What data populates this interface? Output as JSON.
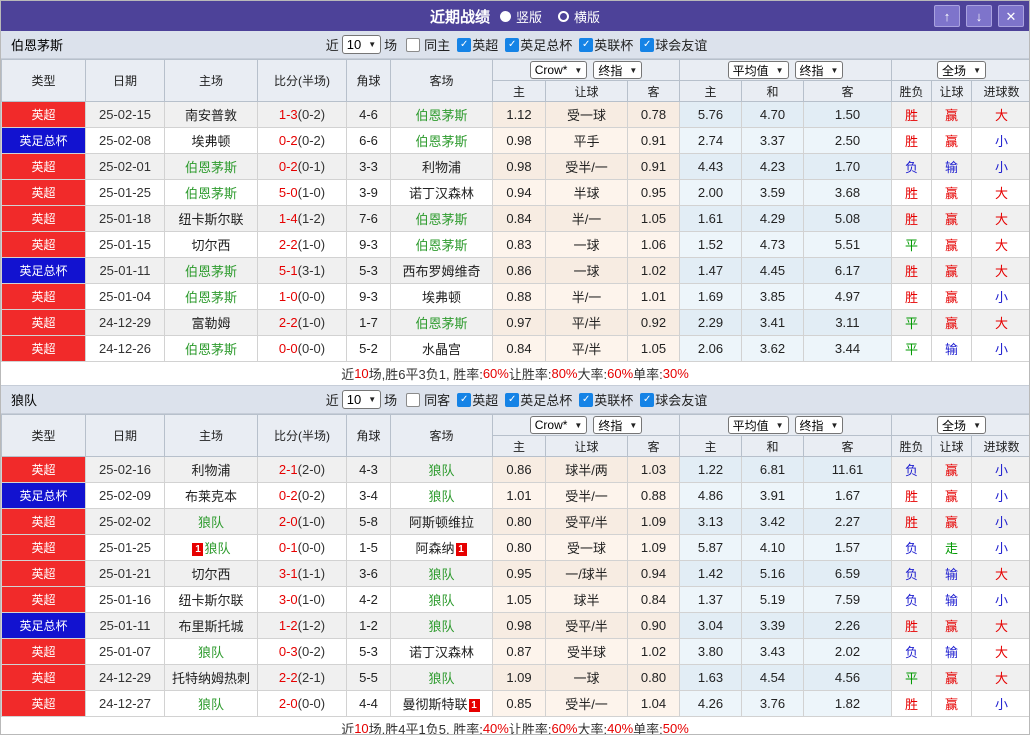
{
  "colors": {
    "titlebar_bg": "#4d4299",
    "titlebar_button_bg": "#7e74cb",
    "section_bg": "#dce2ec",
    "header_bg": "#e9edf3",
    "checkbox_accent": "#1583e6",
    "focal_team": "#2e9b2e",
    "odds_tint": "#fdf4ec",
    "avg_tint": "#edf5fa"
  },
  "league_colors": {
    "英超": "#f12a2a",
    "英足总杯": "#1212d0"
  },
  "result_colors": {
    "r": "#e60000",
    "g": "#009900",
    "b": "#2020d0"
  },
  "icons": {
    "check": "✓",
    "dropdown": "▼"
  },
  "titlebar": {
    "title": "近期战绩",
    "radios": [
      {
        "label": "竖版",
        "selected": true
      },
      {
        "label": "横版",
        "selected": false
      }
    ],
    "buttons": {
      "up": "↑",
      "down": "↓",
      "close": "✕"
    }
  },
  "filter": {
    "near": "近",
    "count": "10",
    "unit": "场",
    "leagues": [
      "英超",
      "英足总杯",
      "英联杯",
      "球会友谊"
    ]
  },
  "table_header": {
    "type": "类型",
    "date": "日期",
    "home": "主场",
    "score": "比分(半场)",
    "corner": "角球",
    "away": "客场",
    "dd_odds_source": "Crow*",
    "dd_odds_time": "终指",
    "dd_avg_source": "平均值",
    "dd_avg_time": "终指",
    "dd_scope": "全场",
    "odds_home": "主",
    "odds_handicap": "让球",
    "odds_away": "客",
    "avg_home": "主",
    "avg_draw": "和",
    "avg_away": "客",
    "res_outcome": "胜负",
    "res_handicap": "让球",
    "res_goals": "进球数"
  },
  "sections": [
    {
      "team": "伯恩茅斯",
      "same_label": "同主",
      "same_checked": false,
      "rows": [
        {
          "league": "英超",
          "date": "25-02-15",
          "home": "南安普敦",
          "home_focal": false,
          "home_rc": "",
          "score": "1-3",
          "half": "(0-2)",
          "corner": "4-6",
          "away": "伯恩茅斯",
          "away_focal": true,
          "away_rc": "",
          "o": [
            "1.12",
            "受一球",
            "0.78"
          ],
          "a": [
            "5.76",
            "4.70",
            "1.50"
          ],
          "res": [
            [
              "胜",
              "r"
            ],
            [
              "赢",
              "r"
            ],
            [
              "大",
              "r"
            ]
          ]
        },
        {
          "league": "英足总杯",
          "date": "25-02-08",
          "home": "埃弗顿",
          "home_focal": false,
          "home_rc": "",
          "score": "0-2",
          "half": "(0-2)",
          "corner": "6-6",
          "away": "伯恩茅斯",
          "away_focal": true,
          "away_rc": "",
          "o": [
            "0.98",
            "平手",
            "0.91"
          ],
          "a": [
            "2.74",
            "3.37",
            "2.50"
          ],
          "res": [
            [
              "胜",
              "r"
            ],
            [
              "赢",
              "r"
            ],
            [
              "小",
              "b"
            ]
          ]
        },
        {
          "league": "英超",
          "date": "25-02-01",
          "home": "伯恩茅斯",
          "home_focal": true,
          "home_rc": "",
          "score": "0-2",
          "half": "(0-1)",
          "corner": "3-3",
          "away": "利物浦",
          "away_focal": false,
          "away_rc": "",
          "o": [
            "0.98",
            "受半/一",
            "0.91"
          ],
          "a": [
            "4.43",
            "4.23",
            "1.70"
          ],
          "res": [
            [
              "负",
              "b"
            ],
            [
              "输",
              "b"
            ],
            [
              "小",
              "b"
            ]
          ]
        },
        {
          "league": "英超",
          "date": "25-01-25",
          "home": "伯恩茅斯",
          "home_focal": true,
          "home_rc": "",
          "score": "5-0",
          "half": "(1-0)",
          "corner": "3-9",
          "away": "诺丁汉森林",
          "away_focal": false,
          "away_rc": "",
          "o": [
            "0.94",
            "半球",
            "0.95"
          ],
          "a": [
            "2.00",
            "3.59",
            "3.68"
          ],
          "res": [
            [
              "胜",
              "r"
            ],
            [
              "赢",
              "r"
            ],
            [
              "大",
              "r"
            ]
          ]
        },
        {
          "league": "英超",
          "date": "25-01-18",
          "home": "纽卡斯尔联",
          "home_focal": false,
          "home_rc": "",
          "score": "1-4",
          "half": "(1-2)",
          "corner": "7-6",
          "away": "伯恩茅斯",
          "away_focal": true,
          "away_rc": "",
          "o": [
            "0.84",
            "半/一",
            "1.05"
          ],
          "a": [
            "1.61",
            "4.29",
            "5.08"
          ],
          "res": [
            [
              "胜",
              "r"
            ],
            [
              "赢",
              "r"
            ],
            [
              "大",
              "r"
            ]
          ]
        },
        {
          "league": "英超",
          "date": "25-01-15",
          "home": "切尔西",
          "home_focal": false,
          "home_rc": "",
          "score": "2-2",
          "half": "(1-0)",
          "corner": "9-3",
          "away": "伯恩茅斯",
          "away_focal": true,
          "away_rc": "",
          "o": [
            "0.83",
            "一球",
            "1.06"
          ],
          "a": [
            "1.52",
            "4.73",
            "5.51"
          ],
          "res": [
            [
              "平",
              "g"
            ],
            [
              "赢",
              "r"
            ],
            [
              "大",
              "r"
            ]
          ]
        },
        {
          "league": "英足总杯",
          "date": "25-01-11",
          "home": "伯恩茅斯",
          "home_focal": true,
          "home_rc": "",
          "score": "5-1",
          "half": "(3-1)",
          "corner": "5-3",
          "away": "西布罗姆维奇",
          "away_focal": false,
          "away_rc": "",
          "o": [
            "0.86",
            "一球",
            "1.02"
          ],
          "a": [
            "1.47",
            "4.45",
            "6.17"
          ],
          "res": [
            [
              "胜",
              "r"
            ],
            [
              "赢",
              "r"
            ],
            [
              "大",
              "r"
            ]
          ]
        },
        {
          "league": "英超",
          "date": "25-01-04",
          "home": "伯恩茅斯",
          "home_focal": true,
          "home_rc": "",
          "score": "1-0",
          "half": "(0-0)",
          "corner": "9-3",
          "away": "埃弗顿",
          "away_focal": false,
          "away_rc": "",
          "o": [
            "0.88",
            "半/一",
            "1.01"
          ],
          "a": [
            "1.69",
            "3.85",
            "4.97"
          ],
          "res": [
            [
              "胜",
              "r"
            ],
            [
              "赢",
              "r"
            ],
            [
              "小",
              "b"
            ]
          ]
        },
        {
          "league": "英超",
          "date": "24-12-29",
          "home": "富勒姆",
          "home_focal": false,
          "home_rc": "",
          "score": "2-2",
          "half": "(1-0)",
          "corner": "1-7",
          "away": "伯恩茅斯",
          "away_focal": true,
          "away_rc": "",
          "o": [
            "0.97",
            "平/半",
            "0.92"
          ],
          "a": [
            "2.29",
            "3.41",
            "3.11"
          ],
          "res": [
            [
              "平",
              "g"
            ],
            [
              "赢",
              "r"
            ],
            [
              "大",
              "r"
            ]
          ]
        },
        {
          "league": "英超",
          "date": "24-12-26",
          "home": "伯恩茅斯",
          "home_focal": true,
          "home_rc": "",
          "score": "0-0",
          "half": "(0-0)",
          "corner": "5-2",
          "away": "水晶宫",
          "away_focal": false,
          "away_rc": "",
          "o": [
            "0.84",
            "平/半",
            "1.05"
          ],
          "a": [
            "2.06",
            "3.62",
            "3.44"
          ],
          "res": [
            [
              "平",
              "g"
            ],
            [
              "输",
              "b"
            ],
            [
              "小",
              "b"
            ]
          ]
        }
      ],
      "summary_parts": [
        [
          "近",
          0
        ],
        [
          "10",
          1
        ],
        [
          "场,胜6平3负1, 胜率:",
          0
        ],
        [
          "60%",
          1
        ],
        [
          " 让胜率:",
          0
        ],
        [
          "80%",
          1
        ],
        [
          " 大率:",
          0
        ],
        [
          "60%",
          1
        ],
        [
          " 单率:",
          0
        ],
        [
          "30%",
          1
        ]
      ]
    },
    {
      "team": "狼队",
      "same_label": "同客",
      "same_checked": false,
      "rows": [
        {
          "league": "英超",
          "date": "25-02-16",
          "home": "利物浦",
          "home_focal": false,
          "home_rc": "",
          "score": "2-1",
          "half": "(2-0)",
          "corner": "4-3",
          "away": "狼队",
          "away_focal": true,
          "away_rc": "",
          "o": [
            "0.86",
            "球半/两",
            "1.03"
          ],
          "a": [
            "1.22",
            "6.81",
            "11.61"
          ],
          "res": [
            [
              "负",
              "b"
            ],
            [
              "赢",
              "r"
            ],
            [
              "小",
              "b"
            ]
          ]
        },
        {
          "league": "英足总杯",
          "date": "25-02-09",
          "home": "布莱克本",
          "home_focal": false,
          "home_rc": "",
          "score": "0-2",
          "half": "(0-2)",
          "corner": "3-4",
          "away": "狼队",
          "away_focal": true,
          "away_rc": "",
          "o": [
            "1.01",
            "受半/一",
            "0.88"
          ],
          "a": [
            "4.86",
            "3.91",
            "1.67"
          ],
          "res": [
            [
              "胜",
              "r"
            ],
            [
              "赢",
              "r"
            ],
            [
              "小",
              "b"
            ]
          ]
        },
        {
          "league": "英超",
          "date": "25-02-02",
          "home": "狼队",
          "home_focal": true,
          "home_rc": "",
          "score": "2-0",
          "half": "(1-0)",
          "corner": "5-8",
          "away": "阿斯顿维拉",
          "away_focal": false,
          "away_rc": "",
          "o": [
            "0.80",
            "受平/半",
            "1.09"
          ],
          "a": [
            "3.13",
            "3.42",
            "2.27"
          ],
          "res": [
            [
              "胜",
              "r"
            ],
            [
              "赢",
              "r"
            ],
            [
              "小",
              "b"
            ]
          ]
        },
        {
          "league": "英超",
          "date": "25-01-25",
          "home": "狼队",
          "home_focal": true,
          "home_rc": "1",
          "score": "0-1",
          "half": "(0-0)",
          "corner": "1-5",
          "away": "阿森纳",
          "away_focal": false,
          "away_rc": "1",
          "o": [
            "0.80",
            "受一球",
            "1.09"
          ],
          "a": [
            "5.87",
            "4.10",
            "1.57"
          ],
          "res": [
            [
              "负",
              "b"
            ],
            [
              "走",
              "g"
            ],
            [
              "小",
              "b"
            ]
          ]
        },
        {
          "league": "英超",
          "date": "25-01-21",
          "home": "切尔西",
          "home_focal": false,
          "home_rc": "",
          "score": "3-1",
          "half": "(1-1)",
          "corner": "3-6",
          "away": "狼队",
          "away_focal": true,
          "away_rc": "",
          "o": [
            "0.95",
            "一/球半",
            "0.94"
          ],
          "a": [
            "1.42",
            "5.16",
            "6.59"
          ],
          "res": [
            [
              "负",
              "b"
            ],
            [
              "输",
              "b"
            ],
            [
              "大",
              "r"
            ]
          ]
        },
        {
          "league": "英超",
          "date": "25-01-16",
          "home": "纽卡斯尔联",
          "home_focal": false,
          "home_rc": "",
          "score": "3-0",
          "half": "(1-0)",
          "corner": "4-2",
          "away": "狼队",
          "away_focal": true,
          "away_rc": "",
          "o": [
            "1.05",
            "球半",
            "0.84"
          ],
          "a": [
            "1.37",
            "5.19",
            "7.59"
          ],
          "res": [
            [
              "负",
              "b"
            ],
            [
              "输",
              "b"
            ],
            [
              "小",
              "b"
            ]
          ]
        },
        {
          "league": "英足总杯",
          "date": "25-01-11",
          "home": "布里斯托城",
          "home_focal": false,
          "home_rc": "",
          "score": "1-2",
          "half": "(1-2)",
          "corner": "1-2",
          "away": "狼队",
          "away_focal": true,
          "away_rc": "",
          "o": [
            "0.98",
            "受平/半",
            "0.90"
          ],
          "a": [
            "3.04",
            "3.39",
            "2.26"
          ],
          "res": [
            [
              "胜",
              "r"
            ],
            [
              "赢",
              "r"
            ],
            [
              "大",
              "r"
            ]
          ]
        },
        {
          "league": "英超",
          "date": "25-01-07",
          "home": "狼队",
          "home_focal": true,
          "home_rc": "",
          "score": "0-3",
          "half": "(0-2)",
          "corner": "5-3",
          "away": "诺丁汉森林",
          "away_focal": false,
          "away_rc": "",
          "o": [
            "0.87",
            "受半球",
            "1.02"
          ],
          "a": [
            "3.80",
            "3.43",
            "2.02"
          ],
          "res": [
            [
              "负",
              "b"
            ],
            [
              "输",
              "b"
            ],
            [
              "大",
              "r"
            ]
          ]
        },
        {
          "league": "英超",
          "date": "24-12-29",
          "home": "托特纳姆热刺",
          "home_focal": false,
          "home_rc": "",
          "score": "2-2",
          "half": "(2-1)",
          "corner": "5-5",
          "away": "狼队",
          "away_focal": true,
          "away_rc": "",
          "o": [
            "1.09",
            "一球",
            "0.80"
          ],
          "a": [
            "1.63",
            "4.54",
            "4.56"
          ],
          "res": [
            [
              "平",
              "g"
            ],
            [
              "赢",
              "r"
            ],
            [
              "大",
              "r"
            ]
          ]
        },
        {
          "league": "英超",
          "date": "24-12-27",
          "home": "狼队",
          "home_focal": true,
          "home_rc": "",
          "score": "2-0",
          "half": "(0-0)",
          "corner": "4-4",
          "away": "曼彻斯特联",
          "away_focal": false,
          "away_rc": "1",
          "o": [
            "0.85",
            "受半/一",
            "1.04"
          ],
          "a": [
            "4.26",
            "3.76",
            "1.82"
          ],
          "res": [
            [
              "胜",
              "r"
            ],
            [
              "赢",
              "r"
            ],
            [
              "小",
              "b"
            ]
          ]
        }
      ],
      "summary_parts": [
        [
          "近",
          0
        ],
        [
          "10",
          1
        ],
        [
          "场,胜4平1负5, 胜率:",
          0
        ],
        [
          "40%",
          1
        ],
        [
          " 让胜率:",
          0
        ],
        [
          "60%",
          1
        ],
        [
          " 大率:",
          0
        ],
        [
          "40%",
          1
        ],
        [
          " 单率:",
          0
        ],
        [
          "50%",
          1
        ]
      ]
    }
  ]
}
